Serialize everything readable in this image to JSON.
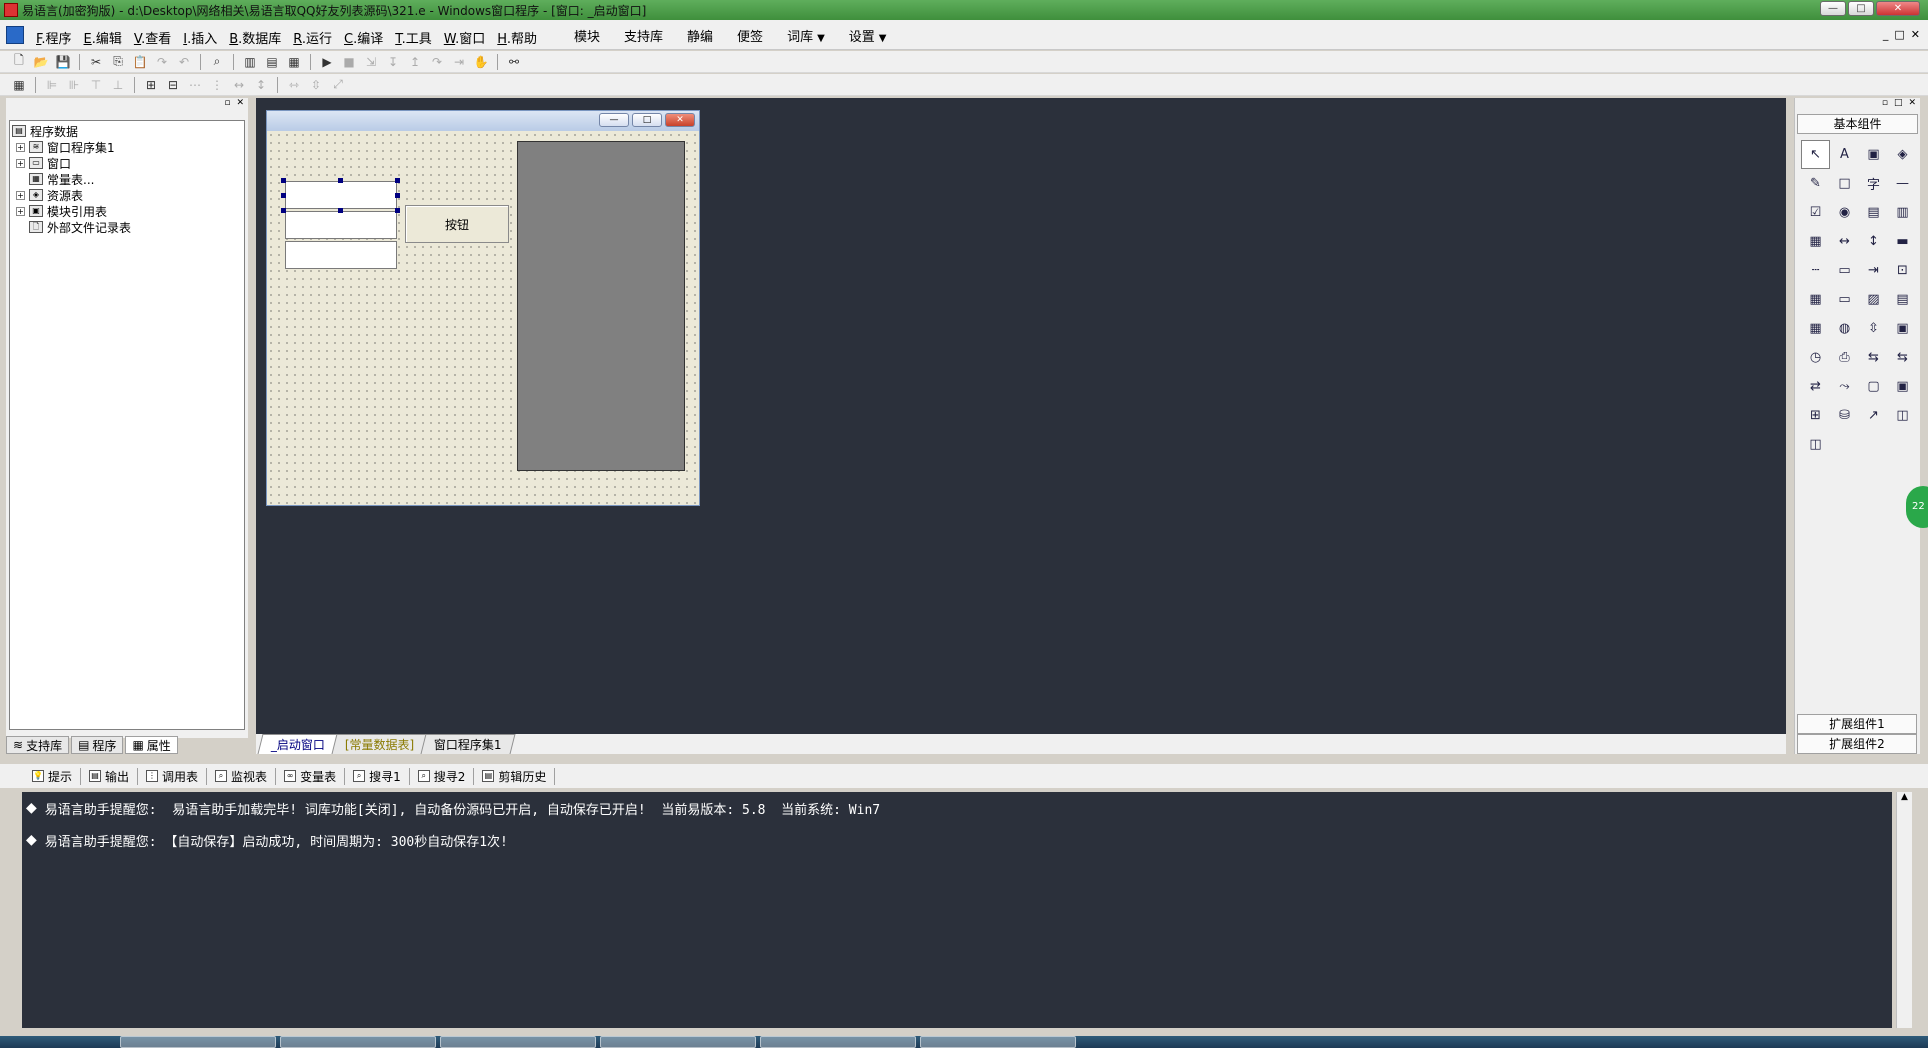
{
  "window": {
    "title": "易语言(加密狗版) - d:\\Desktop\\网络相关\\易语言取QQ好友列表源码\\321.e - Windows窗口程序 - [窗口: _启动窗口]",
    "min_label": "—",
    "max_label": "□",
    "close_label": "✕"
  },
  "menu": {
    "items": [
      {
        "key": "F",
        "label": ".程序"
      },
      {
        "key": "E",
        "label": ".编辑"
      },
      {
        "key": "V",
        "label": ".查看"
      },
      {
        "key": "I",
        "label": ".插入"
      },
      {
        "key": "B",
        "label": ".数据库"
      },
      {
        "key": "R",
        "label": ".运行"
      },
      {
        "key": "C",
        "label": ".编译"
      },
      {
        "key": "T",
        "label": ".工具"
      },
      {
        "key": "W",
        "label": ".窗口"
      },
      {
        "key": "H",
        "label": ".帮助"
      }
    ],
    "right_items": [
      "模块",
      "支持库",
      "静编",
      "便签",
      "词库",
      "设置"
    ],
    "mdi_controls": [
      "_",
      "□",
      "✕"
    ]
  },
  "left_panel": {
    "tree": [
      {
        "label": "程序数据",
        "level": 0,
        "expander": "",
        "icon": "database-icon"
      },
      {
        "label": "窗口程序集1",
        "level": 1,
        "expander": "+",
        "icon": "stack-icon"
      },
      {
        "label": "窗口",
        "level": 1,
        "expander": "+",
        "icon": "window-icon"
      },
      {
        "label": "常量表...",
        "level": 1,
        "expander": "",
        "icon": "table-icon"
      },
      {
        "label": "资源表",
        "level": 1,
        "expander": "+",
        "icon": "resource-icon"
      },
      {
        "label": "模块引用表",
        "level": 1,
        "expander": "+",
        "icon": "module-icon"
      },
      {
        "label": "外部文件记录表",
        "level": 1,
        "expander": "",
        "icon": "file-icon"
      }
    ],
    "tabs": [
      "支持库",
      "程序",
      "属性"
    ]
  },
  "design": {
    "form_button_label": "按钮",
    "doc_tabs": [
      "_启动窗口",
      "[常量数据表]",
      "窗口程序集1"
    ]
  },
  "toolbox": {
    "title": "基本组件",
    "footer1": "扩展组件1",
    "footer2": "扩展组件2",
    "tools": [
      "pointer-icon",
      "label-icon",
      "image-icon",
      "shape-icon",
      "edit-icon",
      "groupbox-icon",
      "text-icon",
      "line-icon",
      "checkbox-icon",
      "radio-icon",
      "listbox-icon",
      "combobox-icon",
      "listview-icon",
      "hscroll-icon",
      "vscroll-icon",
      "progress-icon",
      "ruler-icon",
      "frame-icon",
      "slider-icon",
      "tab-icon",
      "calendar-icon",
      "button-icon",
      "folder-icon",
      "document-icon",
      "table-icon",
      "globe-icon",
      "spin-icon",
      "form-icon",
      "timer-icon",
      "printer-icon",
      "network-icon",
      "network2-icon",
      "client-icon",
      "link-icon",
      "window-icon",
      "panel-icon",
      "tree-icon",
      "db-icon",
      "chart-icon",
      "odbc-icon",
      "odbc2-icon"
    ],
    "glyphs": [
      "↖",
      "A",
      "▣",
      "◈",
      "✎",
      "□",
      "字",
      "—",
      "☑",
      "◉",
      "▤",
      "▥",
      "▦",
      "↔",
      "↕",
      "▬",
      "┄",
      "▭",
      "⇥",
      "⊡",
      "▦",
      "▭",
      "▨",
      "▤",
      "▦",
      "◍",
      "⇳",
      "▣",
      "◷",
      "⎙",
      "⇆",
      "⇆",
      "⇄",
      "⤳",
      "▢",
      "▣",
      "⊞",
      "⛁",
      "↗",
      "◫",
      "◫"
    ]
  },
  "output": {
    "tabs": [
      "提示",
      "输出",
      "调用表",
      "监视表",
      "变量表",
      "搜寻1",
      "搜寻2",
      "剪辑历史"
    ],
    "lines": [
      "易语言助手提醒您:  易语言助手加载完毕! 词库功能[关闭], 自动备份源码已开启, 自动保存已开启!  当前易版本: 5.8  当前系统: Win7",
      "易语言助手提醒您: 【自动保存】启动成功, 时间周期为: 300秒自动保存1次!"
    ]
  },
  "side_badge": "22"
}
